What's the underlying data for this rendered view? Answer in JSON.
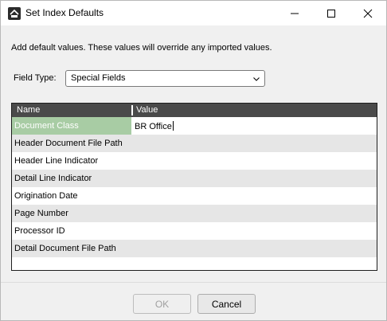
{
  "window": {
    "title": "Set Index Defaults"
  },
  "description": "Add default values. These values will override any imported values.",
  "field_type": {
    "label": "Field Type:",
    "selected": "Special Fields"
  },
  "grid": {
    "columns": [
      "Name",
      "Value"
    ],
    "rows": [
      {
        "name": "Document Class",
        "value": "BR Office"
      },
      {
        "name": "Header Document File Path",
        "value": ""
      },
      {
        "name": "Header Line Indicator",
        "value": ""
      },
      {
        "name": "Detail Line Indicator",
        "value": ""
      },
      {
        "name": "Origination Date",
        "value": ""
      },
      {
        "name": "Page Number",
        "value": ""
      },
      {
        "name": "Processor ID",
        "value": ""
      },
      {
        "name": "Detail Document File Path",
        "value": ""
      }
    ]
  },
  "buttons": {
    "ok": "OK",
    "cancel": "Cancel"
  },
  "icons": {
    "app": "app-logo-icon",
    "minimize": "minimize-icon",
    "maximize": "maximize-icon",
    "close": "close-icon",
    "dropdown": "chevron-down-icon"
  },
  "colors": {
    "selected_row": "#a8cca4",
    "grid_header": "#4a4a4a",
    "alt_row": "#e6e6e6"
  }
}
